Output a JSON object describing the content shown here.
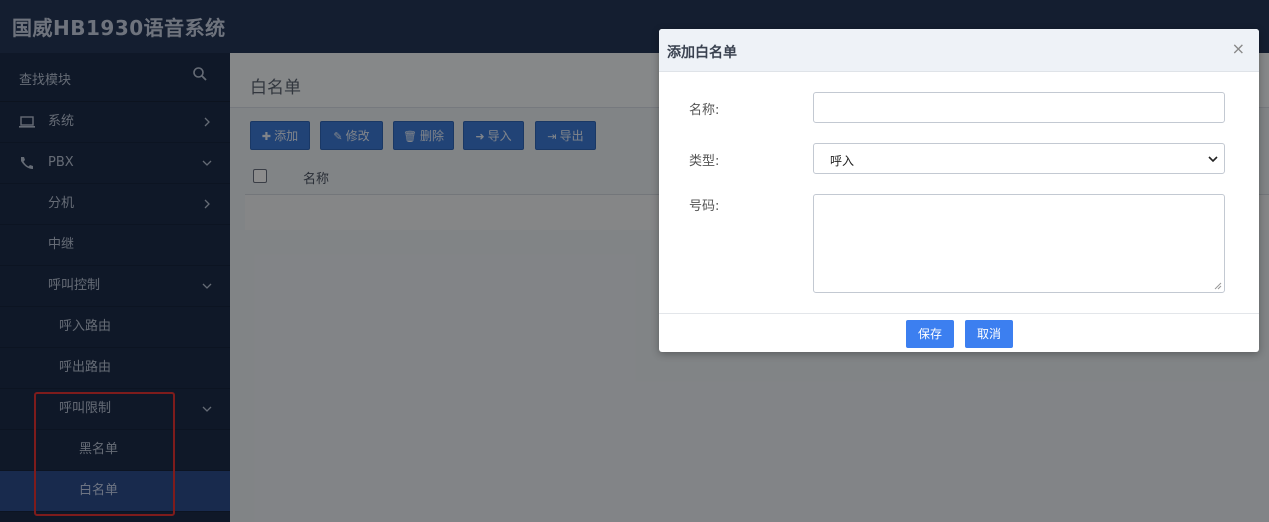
{
  "app": {
    "title": "国威HB1930语音系统"
  },
  "sidebar": {
    "search_label": "查找模块",
    "items": [
      {
        "label": "系统"
      },
      {
        "label": "PBX"
      },
      {
        "label": "分机"
      },
      {
        "label": "中继"
      },
      {
        "label": "呼叫控制"
      },
      {
        "label": "呼入路由"
      },
      {
        "label": "呼出路由"
      },
      {
        "label": "呼叫限制"
      },
      {
        "label": "黑名单"
      },
      {
        "label": "白名单"
      }
    ]
  },
  "page": {
    "title": "白名单"
  },
  "toolbar": {
    "add_label": "添加",
    "edit_label": "修改",
    "delete_label": "删除",
    "import_label": "导入",
    "export_label": "导出"
  },
  "table": {
    "columns": [
      "名称"
    ]
  },
  "modal": {
    "title": "添加白名单",
    "close": "×",
    "name_label": "名称:",
    "name_value": "",
    "type_label": "类型:",
    "type_value": "呼入",
    "number_label": "号码:",
    "number_value": "",
    "save_label": "保存",
    "cancel_label": "取消"
  },
  "colors": {
    "topbar": "#263858",
    "sidebar": "#1d2d4a",
    "active_item": "#2d4d8c",
    "button": "#3c7bd8",
    "highlight": "#e53333"
  }
}
